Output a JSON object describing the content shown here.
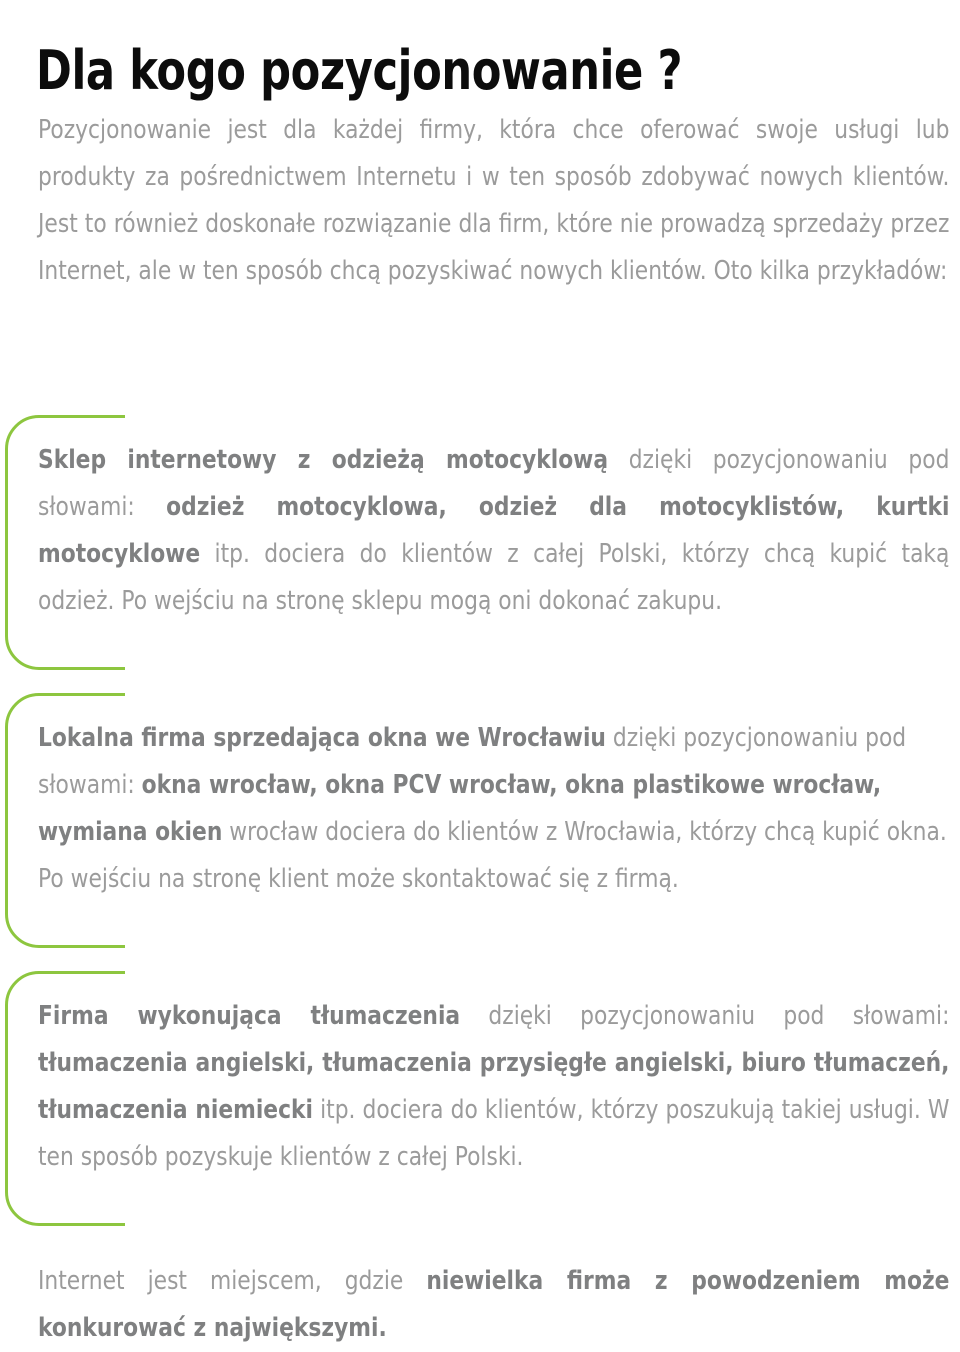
{
  "document": {
    "title": "Dla kogo pozycjonowanie ?",
    "colors": {
      "title_text": "#0c0c0c",
      "body_text": "#9b9b9b",
      "bold_text": "#7f8081",
      "bracket_green": "#8dc63f",
      "background": "#ffffff"
    }
  },
  "intro": {
    "html": "Pozycjonowanie jest dla każdej firmy, która chce oferować swoje usługi lub produkty za pośrednictwem Internetu i w ten sposób zdobywać nowych klientów. Jest to również doskonałe rozwiązanie dla firm, które nie prowadzą sprzedaży przez Internet, ale w ten sposób chcą pozyskiwać nowych klientów. Oto kilka przykładów:",
    "plain": "Pozycjonowanie jest dla każdej firmy, która chce oferować swoje usługi lub produkty za pośrednictwem Internetu i w ten sposób zdobywać nowych klientów. Jest to również doskonałe rozwiązanie dla firm, które nie prowadzą sprzedaży przez Internet, ale w ten sposób chcą pozyskiwać nowych klientów. Oto kilka przykładów:"
  },
  "examples": [
    {
      "id": "example-sklep-odziez-motocyklowa",
      "bold_lead": "Sklep internetowy z odzieżą motocyklową",
      "keywords": [
        "odzież motocyklowa",
        "odzież dla motocyklistów",
        "kurtki motocyklowe"
      ],
      "html": "<b>Sklep internetowy z odzieżą motocyklową</b> dzięki pozycjonowaniu pod słowami: <b>odzież motocyklowa, odzież dla motocyklistów, kurtki motocyklowe</b> itp. dociera do klientów z całej Polski, którzy chcą kupić taką odzież. Po wejściu na stronę sklepu mogą oni dokonać zakupu.",
      "plain": "Sklep internetowy z odzieżą motocyklową dzięki pozycjonowaniu pod słowami: odzież motocyklowa, odzież dla motocyklistów, kurtki motocyklowe itp. dociera do klientów z całej Polski, którzy chcą kupić taką odzież. Po wejściu na stronę sklepu mogą oni dokonać zakupu."
    },
    {
      "id": "example-lokalna-firma-okna-wroclaw",
      "bold_lead": "Lokalna firma sprzedająca okna we Wrocławiu",
      "keywords": [
        "okna wrocław",
        "okna PCV wrocław",
        "okna plastikowe wrocław",
        "wymiana okien"
      ],
      "html": "<b>Lokalna firma sprzedająca okna we Wrocławiu</b> dzięki pozycjonowaniu pod słowami: <b>okna wrocław, okna PCV wrocław, okna plastikowe wrocław, wymiana okien</b> wrocław dociera do klientów z Wrocławia, którzy chcą kupić okna. Po wejściu na stronę klient może skontaktować się z firmą.",
      "plain": "Lokalna firma sprzedająca okna we Wrocławiu dzięki pozycjonowaniu pod słowami: okna wrocław, okna PCV wrocław, okna plastikowe wrocław, wymiana okien wrocław dociera do klientów z Wrocławia, którzy chcą kupić okna. Po wejściu na stronę klient może skontaktować się z firmą."
    },
    {
      "id": "example-firma-tlumaczenia",
      "bold_lead": "Firma wykonująca tłumaczenia",
      "keywords": [
        "tłumaczenia angielski",
        "tłumaczenia przysięgłe angielski",
        "biuro tłumaczeń",
        "tłumaczenia niemiecki"
      ],
      "html": "<b>Firma wykonująca tłumaczenia</b> dzięki pozycjonowaniu pod słowami: <b>tłumaczenia angielski, tłumaczenia przysięgłe angielski, biuro tłumaczeń, tłumaczenia niemiecki</b> itp. dociera do klientów, którzy poszukują takiej usługi. W ten sposób pozyskuje klientów z całej Polski.",
      "plain": "Firma wykonująca tłumaczenia dzięki pozycjonowaniu pod słowami: tłumaczenia angielski, tłumaczenia przysięgłe angielski, biuro tłumaczeń, tłumaczenia niemiecki itp. dociera do klientów, którzy poszukują takiej usługi. W ten sposób pozyskuje klientów z całej Polski."
    }
  ],
  "conclusion": {
    "html": "Internet jest miejscem, gdzie <b>niewielka firma z powodzeniem może konkurować z największymi.</b>",
    "plain": "Internet jest miejscem, gdzie niewielka firma z powodzeniem może konkurować z największymi."
  }
}
